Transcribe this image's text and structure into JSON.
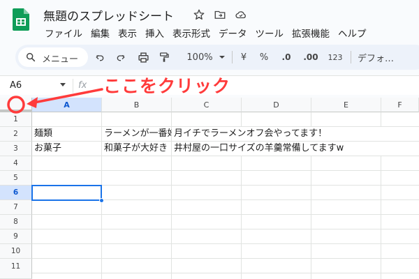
{
  "document": {
    "title": "無題のスプレッドシート"
  },
  "menu": {
    "items": [
      "ファイル",
      "編集",
      "表示",
      "挿入",
      "表示形式",
      "データ",
      "ツール",
      "拡張機能",
      "ヘルプ"
    ]
  },
  "toolbar": {
    "search_label": "メニュー",
    "zoom": "100%",
    "currency_label": "¥",
    "percent_label": "%",
    "decrease_decimal_label": ".0",
    "increase_decimal_label": ".00",
    "number_format_label": "123",
    "font_label": "デフォ…"
  },
  "formula_bar": {
    "name_box": "A6",
    "fx_label": "fx"
  },
  "grid": {
    "columns": [
      "A",
      "B",
      "C",
      "D",
      "E",
      "F"
    ],
    "active_column": "A",
    "rows": [
      "1",
      "2",
      "3",
      "4",
      "5",
      "6",
      "7",
      "8",
      "9",
      "10",
      "11"
    ],
    "active_row": "6",
    "cells": {
      "a2": "麺類",
      "b2": "ラーメンが一番好き",
      "c2": "月イチでラーメンオフ会やってます！",
      "a3": "お菓子",
      "b3": "和菓子が大好き",
      "c3": "井村屋の一口サイズの羊羹常備してますw"
    }
  },
  "annotation": {
    "text": "ここをクリック",
    "color": "#ff3b3b"
  },
  "colors": {
    "accent": "#1a73e8",
    "header_active": "#d3e3fd",
    "sheets_green": "#0f9d58"
  }
}
